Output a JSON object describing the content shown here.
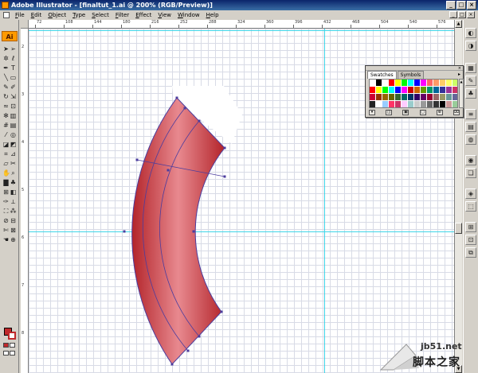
{
  "window": {
    "title": "Adobe Illustrator - [finaltut_1.ai @ 200% (RGB/Preview)]",
    "minimize_glyph": "_",
    "maximize_glyph": "□",
    "close_glyph": "×"
  },
  "menu": {
    "items": [
      "File",
      "Edit",
      "Object",
      "Type",
      "Select",
      "Filter",
      "Effect",
      "View",
      "Window",
      "Help"
    ]
  },
  "rulers": {
    "top_labels": [
      "72",
      "108",
      "144",
      "180",
      "216",
      "252",
      "288",
      "324",
      "360",
      "396",
      "432",
      "468",
      "504",
      "540",
      "576"
    ],
    "left_labels": [
      "2",
      "3",
      "4",
      "5",
      "6",
      "7",
      "8"
    ]
  },
  "toolbox": {
    "logo_text": "Ai",
    "fill_color": "#c0292b",
    "stroke_color": "#c0292b"
  },
  "swatches_panel": {
    "tabs": [
      "Swatches",
      "Symbols"
    ],
    "active_tab": "Swatches",
    "menu_glyph": "▸",
    "colors": [
      "#ffffff",
      "#000000",
      "#ffffff",
      "#ff0000",
      "#ffff00",
      "#00ff00",
      "#00ffff",
      "#0000ff",
      "#ff00ff",
      "#ff6666",
      "#ff9966",
      "#ffcc66",
      "#ffff66",
      "#ccff66",
      "#ff0000",
      "#ffff00",
      "#00ff00",
      "#00ffff",
      "#0000ff",
      "#ff00ff",
      "#cc0000",
      "#cc6600",
      "#669900",
      "#009966",
      "#006699",
      "#333399",
      "#993399",
      "#cc3366",
      "#cc0033",
      "#993300",
      "#996600",
      "#666600",
      "#336633",
      "#006666",
      "#003366",
      "#330066",
      "#660066",
      "#990033",
      "#996666",
      "#999966",
      "#669999",
      "#666699",
      "#222222",
      "#ffffff",
      "#99ccff",
      "#ff3366",
      "#cc3366",
      "#ffccff",
      "#99cccc",
      "#cccccc",
      "#999999",
      "#666666",
      "#333333",
      "#000000",
      "#cc9999",
      "#99cc99"
    ],
    "scroll_up": "▲",
    "scroll_down": "▼",
    "footer_icons": [
      "show-kinds-icon",
      "swatch-options-icon",
      "new-color-group-icon",
      "swatch-library-icon",
      "new-swatch-icon",
      "delete-swatch-icon"
    ]
  },
  "artwork": {
    "arc_fill_dark": "#b3242a",
    "arc_fill_light": "#e8898f",
    "path_color": "#4b3c9e",
    "guide_color": "#3fd6e8"
  },
  "watermark": {
    "url": "jb51.net",
    "site_name": "脚本之家"
  }
}
